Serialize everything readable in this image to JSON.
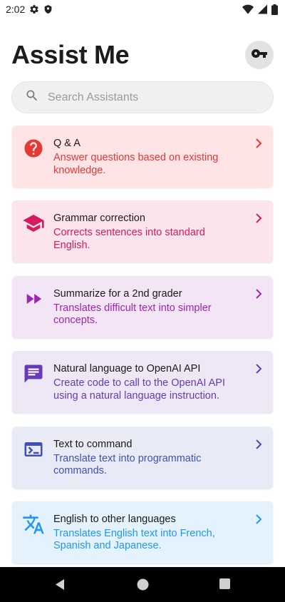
{
  "status_bar": {
    "time": "2:02",
    "icons": [
      "gear-icon",
      "shield-icon",
      "wifi-icon",
      "cellular-icon",
      "battery-icon"
    ]
  },
  "header": {
    "title": "Assist Me",
    "key_button_icon": "key-icon"
  },
  "search": {
    "placeholder": "Search Assistants",
    "value": ""
  },
  "assistants": [
    {
      "title": "Q & A",
      "description": "Answer questions based on existing knowledge.",
      "icon": "question-icon",
      "bg_color": "#ffe4e5",
      "accent_color": "#e53935"
    },
    {
      "title": "Grammar correction",
      "description": "Corrects sentences into standard English.",
      "icon": "school-icon",
      "bg_color": "#fbe4ec",
      "accent_color": "#d81b60"
    },
    {
      "title": "Summarize for a 2nd grader",
      "description": "Translates difficult text into simpler concepts.",
      "icon": "fast-forward-icon",
      "bg_color": "#f3e5f5",
      "accent_color": "#9c27b0"
    },
    {
      "title": "Natural language to OpenAI API",
      "description": "Create code to call to the OpenAI API using a natural language instruction.",
      "icon": "message-icon",
      "bg_color": "#ede7f6",
      "accent_color": "#673ab7"
    },
    {
      "title": "Text to command",
      "description": "Translate text into programmatic commands.",
      "icon": "terminal-icon",
      "bg_color": "#e8eaf6",
      "accent_color": "#3f51b5"
    },
    {
      "title": "English to other languages",
      "description": "Translates English text into French, Spanish and Japanese.",
      "icon": "translate-icon",
      "bg_color": "#e3f2fd",
      "accent_color": "#2196f3"
    }
  ],
  "nav_bar": {
    "icons": [
      "back-icon",
      "home-icon",
      "recents-icon"
    ]
  }
}
